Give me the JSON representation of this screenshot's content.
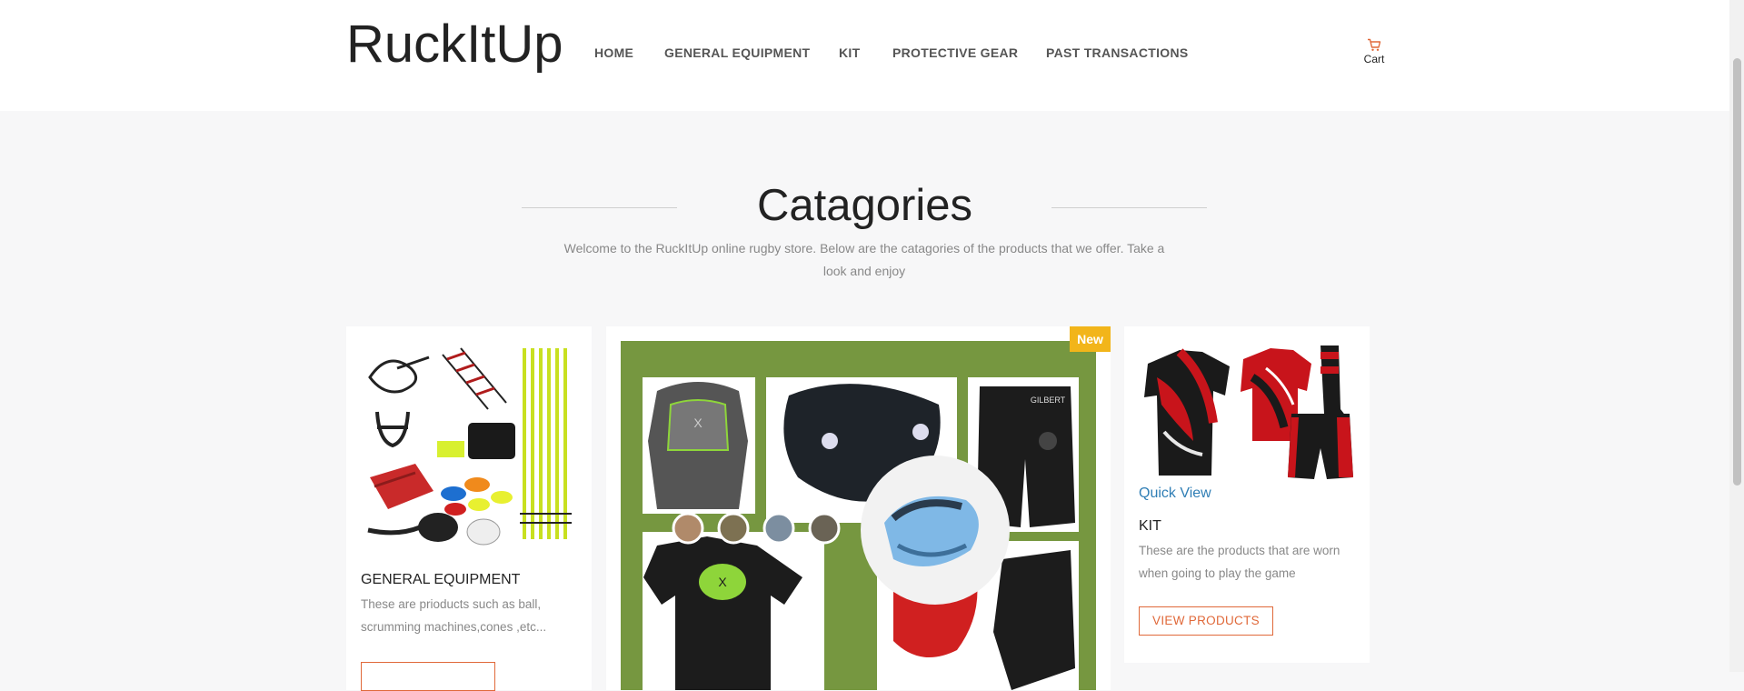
{
  "brand": {
    "logo_text": "RuckItUp"
  },
  "nav": {
    "items": [
      "HOME",
      "GENERAL EQUIPMENT",
      "KIT",
      "PROTECTIVE GEAR",
      "PAST TRANSACTIONS"
    ]
  },
  "cart": {
    "label": "Cart",
    "icon": "cart-icon"
  },
  "section": {
    "title": "Catagories",
    "description": "Welcome to the RuckItUp online rugby store. Below are the catagories of the products that we offer. Take a look and enjoy"
  },
  "cards": [
    {
      "title": "GENERAL EQUIPMENT",
      "description": "These are prioducts such as ball, scrumming machines,cones ,etc...",
      "button": ""
    },
    {
      "badge": "New"
    },
    {
      "quick_view": "Quick View",
      "title": "KIT",
      "description": "These are the products that are worn when going to play the game",
      "button": "VIEW PRODUCTS"
    }
  ],
  "colors": {
    "accent": "#e0693a",
    "badge": "#f2b51a",
    "link": "#2f7eb5",
    "kit_red": "#c8141b",
    "gear_green": "#8ed53a"
  }
}
